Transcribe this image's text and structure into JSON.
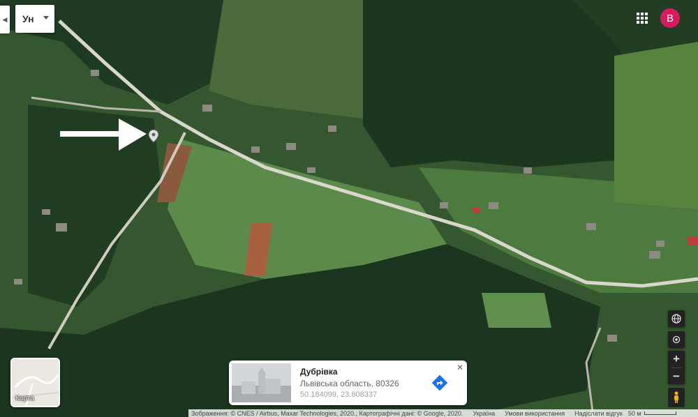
{
  "map": {
    "type": "satellite",
    "arrow_annotation": "white-arrow-pointing-at-marker"
  },
  "top_left": {
    "search_text": "Ун"
  },
  "account": {
    "initial": "B",
    "color": "#d81b60"
  },
  "layer_toggle": {
    "label": "Карта"
  },
  "place_card": {
    "name": "Дубрівка",
    "region": "Львівська область, 80326",
    "coordinates": "50.184099, 23.608337",
    "close_label": "✕"
  },
  "controls": {
    "globe_icon": "globe-icon",
    "location_icon": "my-location-icon",
    "zoom_in": "+",
    "zoom_out": "−",
    "pegman_icon": "pegman-icon"
  },
  "footer": {
    "attribution": "Зображення: © CNES / Airbus, Maxar Technologies, 2020., Картографічні дані: © Google, 2020.",
    "country": "Україна",
    "terms": "Умови використання",
    "feedback": "Надіслати відгук",
    "scale": "50 м"
  }
}
